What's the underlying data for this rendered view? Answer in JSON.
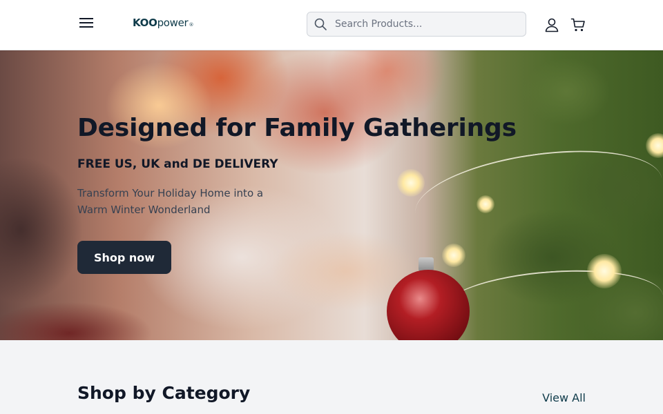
{
  "header": {
    "logo": {
      "part1": "KOO",
      "part2": "power",
      "mark": "®"
    },
    "search": {
      "placeholder": "Search Products...",
      "value": ""
    },
    "icons": [
      "menu-icon",
      "search-icon",
      "user-icon",
      "cart-icon"
    ]
  },
  "hero": {
    "title": "Designed for Family Gatherings",
    "subtitle": "FREE US, UK and DE DELIVERY",
    "description": "Transform Your Holiday Home into a Warm Winter Wonderland",
    "cta_label": "Shop now"
  },
  "categories": {
    "title": "Shop by Category",
    "view_all_label": "View All"
  },
  "colors": {
    "brand": "#0f3b4a",
    "button_dark": "#1f2937",
    "text_dark": "#111827",
    "section_bg": "#f3f4f6"
  }
}
